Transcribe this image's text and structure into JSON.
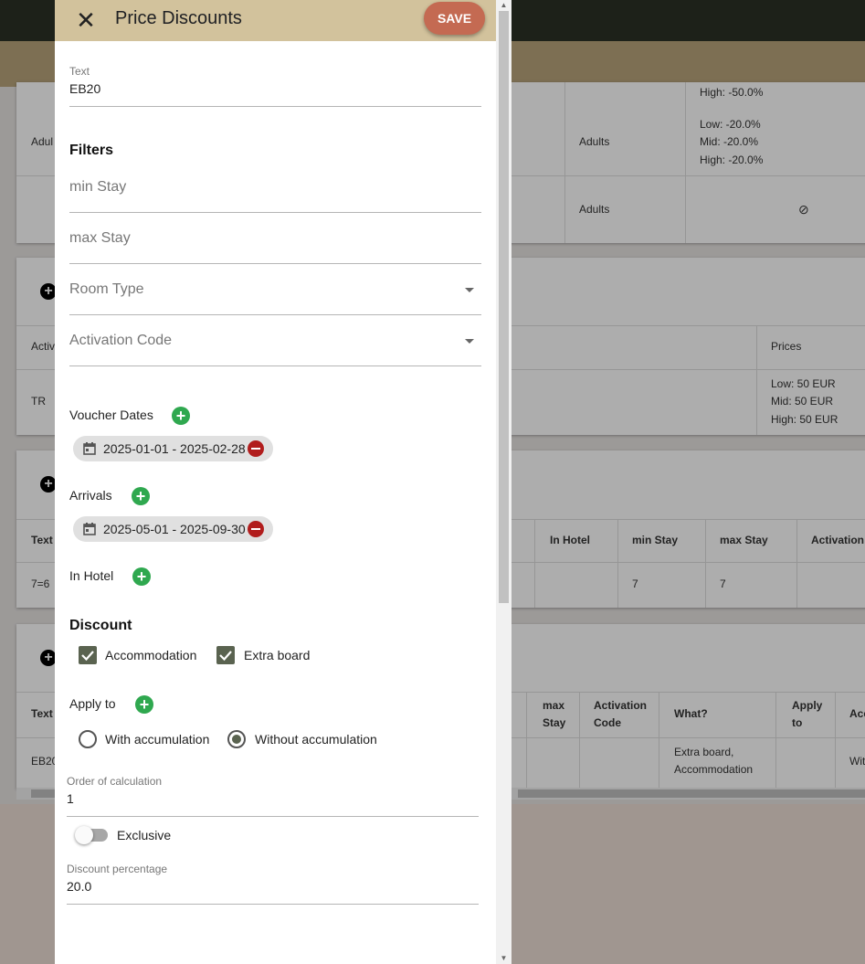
{
  "drawer": {
    "title": "Price Discounts",
    "save_label": "SAVE",
    "text_field": {
      "label": "Text",
      "value": "EB20"
    },
    "filters": {
      "heading": "Filters",
      "min_stay_placeholder": "min Stay",
      "max_stay_placeholder": "max Stay",
      "room_type_placeholder": "Room Type",
      "activation_code_placeholder": "Activation Code"
    },
    "voucher_dates": {
      "label": "Voucher Dates",
      "chips": [
        "2025-01-01 - 2025-02-28"
      ]
    },
    "arrivals": {
      "label": "Arrivals",
      "chips": [
        "2025-05-01 - 2025-09-30"
      ]
    },
    "in_hotel": {
      "label": "In Hotel"
    },
    "discount": {
      "heading": "Discount",
      "accommodation_label": "Accommodation",
      "accommodation_checked": true,
      "extra_board_label": "Extra board",
      "extra_board_checked": true
    },
    "apply_to": {
      "label": "Apply to",
      "with_accumulation_label": "With accumulation",
      "without_accumulation_label": "Without accumulation",
      "selected": "without_accumulation"
    },
    "order_of_calculation": {
      "label": "Order of calculation",
      "value": "1"
    },
    "exclusive": {
      "label": "Exclusive",
      "on": false
    },
    "discount_percentage": {
      "label": "Discount percentage",
      "value": "20.0"
    }
  },
  "background": {
    "card1": {
      "row0_price_partial": "High:   -50.0%",
      "row1_text_partial": "Adul",
      "row1_who": "Adults",
      "row1_prices": [
        "Low:   -20.0%",
        "Mid:   -20.0%",
        "High:   -20.0%"
      ],
      "row2_who": "Adults",
      "row2_prices_icon": "⊘"
    },
    "card2": {
      "header_text_partial": "Activ",
      "header_prices": "Prices",
      "row_text": "TR",
      "row_prices": [
        "Low:     50 EUR",
        "Mid:     50 EUR",
        "High:    50 EUR"
      ]
    },
    "card3": {
      "headers": {
        "text": "Text",
        "in_hotel": "In Hotel",
        "min_stay": "min Stay",
        "max_stay": "max Stay",
        "activation": "Activation"
      },
      "row": {
        "text": "7=6",
        "min_stay": "7",
        "max_stay": "7"
      }
    },
    "card4": {
      "headers": {
        "text": "Text",
        "max_stay": "max\nStay",
        "activation_code": "Activation\nCode",
        "what": "What?",
        "apply_to": "Apply\nto",
        "acc": "Acc"
      },
      "row": {
        "text": "EB20",
        "what": "Extra board,\nAccommodation",
        "acc": "Wit"
      }
    }
  }
}
